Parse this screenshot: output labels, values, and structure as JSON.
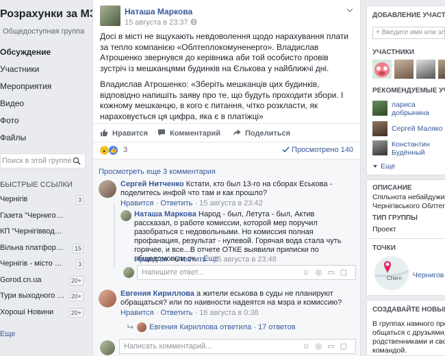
{
  "group": {
    "name": "Розрахунки за МЗК",
    "type": "Общедоступная группа"
  },
  "left_nav": [
    {
      "label": "Обсуждение",
      "active": true
    },
    {
      "label": "Участники"
    },
    {
      "label": "Мероприятия"
    },
    {
      "label": "Видео"
    },
    {
      "label": "Фото"
    },
    {
      "label": "Файлы"
    }
  ],
  "group_search": {
    "placeholder": "Поиск в этой группе"
  },
  "quick_links": {
    "title": "Быстрые ссылки",
    "items": [
      {
        "label": "Чернігів",
        "badge": "3"
      },
      {
        "label": "Газета \"Черниговские ...",
        "badge": ""
      },
      {
        "label": "КП \"Чернігівводоканал\"",
        "badge": ""
      },
      {
        "label": "Вільна платформа ...",
        "badge": "15"
      },
      {
        "label": "Чернігів - місто легенд",
        "badge": "3"
      },
      {
        "label": "Gorod.cn.ua",
        "badge": "20+"
      },
      {
        "label": "Тури выходного д...",
        "badge": "20+"
      },
      {
        "label": "Хороші Новини",
        "badge": "20+"
      }
    ],
    "more": "Еще"
  },
  "post": {
    "author": "Наташа Маркова",
    "date": "15 августа в 23:37",
    "paragraph1": "Досі в місті не вщухають невдоволення щодо нарахування плати за тепло компанією «Облтеплокомуненерго». Владислав Атрошенко звернувся до керівника аби той особисто провів зустріч із мешканцями будинків на Єлькова у найближчі дні.",
    "paragraph2": "Владислав Атрошенко: «Зберіть мешканців цих будинків, відповідно напишіть заяву про те, що будуть проходити збори. І кожному мешканцю, в кого є питання, чітко розкласти, як нараховується ця цифра, яка є в платіжці»",
    "actions": {
      "like": "Нравится",
      "comment": "Комментарий",
      "share": "Поделиться"
    },
    "reactions_count": "3",
    "views": "Просмотрено 140"
  },
  "comments": {
    "see_more": "Просмотреть еще 3 комментария",
    "items": [
      {
        "author": "Сергей Нитченко",
        "text": "Кстати, кто был 13-го на сборах Еськова - поделитесь инфой что там и как прошло?",
        "like": "Нравится",
        "reply": "Ответить",
        "date": "15 августа в 23:42"
      },
      {
        "author": "Наташа Маркова",
        "text": "Народ - был, Летута - был, Актив рассказал, о работе комиссии, которой мер поручил разобраться с недовольными. Но комиссия полная профанация, результат - нулевой. Горячая вода стала чуть горячее, и все...В отчете ОТКЕ выявили приписки по общедомовым сч...",
        "more": "Еще",
        "like": "Нравится",
        "reply": "Ответить",
        "date": "15 августа в 23:48"
      },
      {
        "author": "Евгения Кириллова",
        "text": "а жители еськова в суды не планируют обращаться? или по наивности надеятся на мэра и комиссию?",
        "like": "Нравится",
        "reply": "Ответить",
        "date": "16 августа в 0:38"
      }
    ],
    "reply_placeholder": "Напишите ответ...",
    "replies_summary": "Евгения Кириллова ответила",
    "replies_count": "17 ответов",
    "new_comment_placeholder": "Написать комментарий..."
  },
  "right": {
    "add_members_title": "Добавление участни",
    "add_members_placeholder": "+ Введите имя или эл. ад",
    "members_title": "Участники",
    "recommended_title": "Рекомендуемые учас",
    "recommended": [
      {
        "name1": "лариса",
        "name2": "добрынина"
      },
      {
        "name1": "Сергей Маляко",
        "name2": ""
      },
      {
        "name1": "Константин",
        "name2": "Будённый"
      }
    ],
    "more": "Еще",
    "description_title": "Описание",
    "description": [
      "Спільнота небайдужих,",
      "Чернігівського Облтеп"
    ],
    "type_title": "Тип группы",
    "type_value": "Проект",
    "places_title": "Точки",
    "place_name": "Чернигов",
    "map_label": "Chern",
    "create_title": "Создавайте новые г",
    "create_text": [
      "В группах намного прош",
      "общаться с друзьями,",
      "родственниками и свое",
      "командой."
    ]
  }
}
